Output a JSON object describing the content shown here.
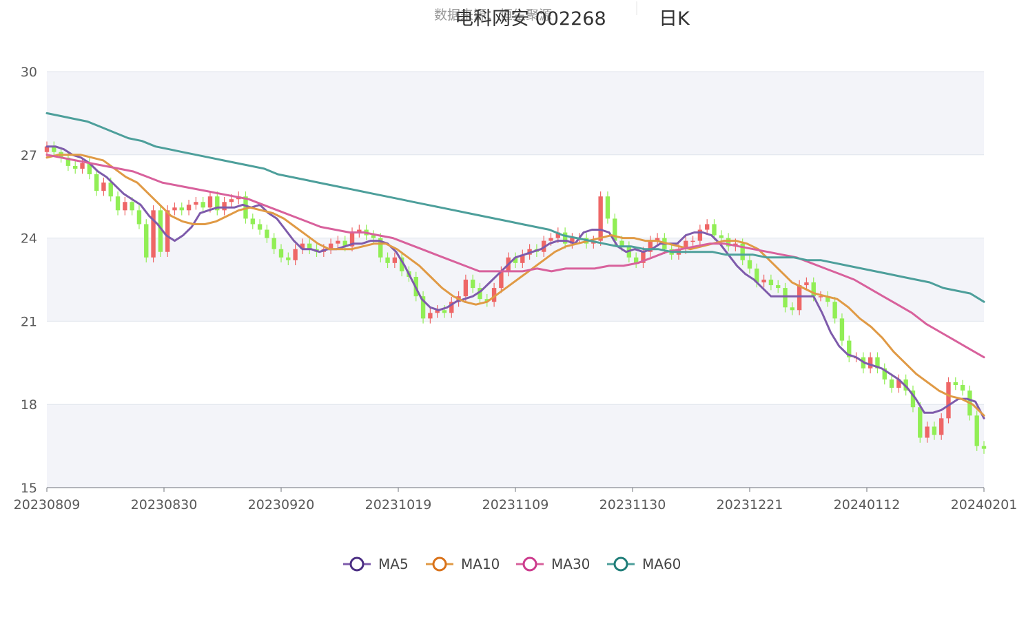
{
  "chart_data": {
    "type": "candlestick",
    "title": "电科网安 002268",
    "title_suffix": "日K",
    "source": "数据来源：恒生聚源",
    "ylim": [
      15,
      30
    ],
    "yticks": [
      15,
      18,
      21,
      24,
      27,
      30
    ],
    "xticks": [
      "20230809",
      "20230830",
      "20230920",
      "20231019",
      "20231109",
      "20231130",
      "20231221",
      "20240112",
      "20240201"
    ],
    "grid": true,
    "legend_position": "bottom-center",
    "colors": {
      "up": "#ee6666",
      "down": "#91ee55",
      "band": "#f3f4f9",
      "grid": "#e0e4ec",
      "axis": "#6e7079",
      "ma5": "#7e5bab",
      "ma10": "#e09a45",
      "ma30": "#d8619c",
      "ma60": "#4d9f9b"
    },
    "legend": [
      {
        "name": "MA5",
        "key": "ma5",
        "ring": "#4b2e83"
      },
      {
        "name": "MA10",
        "key": "ma10",
        "ring": "#d9721a"
      },
      {
        "name": "MA30",
        "key": "ma30",
        "ring": "#cc3b8d"
      },
      {
        "name": "MA60",
        "key": "ma60",
        "ring": "#1f7d78"
      }
    ],
    "close": [
      27.3,
      27.1,
      26.9,
      26.6,
      26.5,
      26.7,
      26.3,
      25.7,
      26.0,
      25.5,
      25.0,
      25.3,
      25.0,
      24.5,
      23.3,
      25.0,
      23.5,
      25.0,
      25.1,
      25.0,
      25.2,
      25.3,
      25.1,
      25.5,
      25.0,
      25.3,
      25.4,
      25.5,
      24.7,
      24.5,
      24.3,
      24.0,
      23.6,
      23.3,
      23.2,
      23.6,
      23.8,
      23.6,
      23.5,
      23.6,
      23.8,
      23.9,
      23.7,
      24.2,
      24.3,
      24.1,
      24.0,
      23.3,
      23.1,
      23.3,
      22.8,
      22.6,
      21.9,
      21.1,
      21.3,
      21.4,
      21.3,
      21.7,
      21.9,
      22.5,
      22.2,
      21.8,
      21.7,
      22.2,
      22.8,
      23.3,
      23.1,
      23.4,
      23.6,
      23.5,
      23.9,
      24.0,
      24.2,
      23.8,
      24.0,
      24.0,
      23.8,
      23.9,
      25.5,
      24.7,
      23.9,
      23.7,
      23.3,
      23.1,
      23.5,
      23.9,
      24.0,
      23.6,
      23.4,
      23.6,
      23.9,
      23.9,
      24.3,
      24.5,
      24.1,
      24.0,
      23.7,
      23.8,
      23.2,
      22.9,
      22.4,
      22.5,
      22.3,
      22.2,
      21.5,
      21.4,
      22.3,
      22.4,
      21.9,
      21.9,
      21.7,
      21.1,
      20.3,
      19.7,
      19.7,
      19.3,
      19.7,
      19.3,
      18.9,
      18.6,
      18.9,
      18.5,
      17.9,
      16.8,
      17.2,
      16.9,
      17.5,
      18.8,
      18.7,
      18.5,
      17.6,
      16.5,
      16.4
    ],
    "ma5": [
      27.3,
      27.3,
      27.2,
      27.0,
      26.9,
      26.7,
      26.4,
      26.2,
      25.9,
      25.6,
      25.4,
      25.2,
      24.8,
      24.5,
      24.1,
      23.9,
      24.1,
      24.4,
      24.9,
      25.0,
      25.1,
      25.1,
      25.1,
      25.2,
      25.1,
      25.2,
      24.9,
      24.7,
      24.3,
      23.9,
      23.6,
      23.6,
      23.5,
      23.6,
      23.6,
      23.7,
      23.8,
      23.8,
      23.9,
      23.9,
      23.8,
      23.5,
      23.0,
      22.4,
      21.8,
      21.5,
      21.4,
      21.5,
      21.7,
      21.8,
      21.9,
      22.1,
      22.4,
      22.7,
      23.0,
      23.3,
      23.4,
      23.5,
      23.6,
      23.8,
      23.9,
      23.9,
      23.8,
      24.2,
      24.3,
      24.3,
      24.2,
      23.7,
      23.5,
      23.6,
      23.5,
      23.6,
      23.8,
      23.8,
      23.8,
      24.1,
      24.2,
      24.2,
      24.1,
      23.8,
      23.4,
      23.0,
      22.7,
      22.5,
      22.2,
      21.9,
      21.9,
      21.9,
      21.9,
      21.9,
      21.9,
      21.3,
      20.6,
      20.1,
      19.8,
      19.7,
      19.5,
      19.4,
      19.3,
      19.1,
      18.9,
      18.6,
      18.2,
      17.7,
      17.7,
      17.8,
      18.0,
      18.2,
      18.2,
      18.1,
      17.5
    ],
    "ma10": [
      26.9,
      27.0,
      27.0,
      27.0,
      26.9,
      26.8,
      26.5,
      26.2,
      26.0,
      25.6,
      25.2,
      24.8,
      24.6,
      24.5,
      24.5,
      24.6,
      24.8,
      25.0,
      25.1,
      25.0,
      24.9,
      24.7,
      24.4,
      24.1,
      23.8,
      23.6,
      23.6,
      23.6,
      23.7,
      23.8,
      23.8,
      23.6,
      23.3,
      23.0,
      22.6,
      22.2,
      21.9,
      21.7,
      21.6,
      21.7,
      22.0,
      22.3,
      22.6,
      22.9,
      23.2,
      23.5,
      23.7,
      23.8,
      23.9,
      24.0,
      24.1,
      24.0,
      24.0,
      23.9,
      23.9,
      23.8,
      23.7,
      23.6,
      23.7,
      23.8,
      23.9,
      23.9,
      23.8,
      23.6,
      23.2,
      22.8,
      22.4,
      22.2,
      22.0,
      21.9,
      21.8,
      21.5,
      21.1,
      20.8,
      20.4,
      19.9,
      19.5,
      19.1,
      18.8,
      18.5,
      18.3,
      18.2,
      18.0,
      17.6
    ],
    "ma30": [
      27.0,
      26.9,
      26.8,
      26.7,
      26.6,
      26.5,
      26.4,
      26.2,
      26.0,
      25.9,
      25.8,
      25.7,
      25.6,
      25.5,
      25.4,
      25.2,
      25.0,
      24.8,
      24.6,
      24.4,
      24.3,
      24.2,
      24.2,
      24.1,
      24.0,
      23.8,
      23.6,
      23.4,
      23.2,
      23.0,
      22.8,
      22.8,
      22.8,
      22.8,
      22.9,
      22.8,
      22.9,
      22.9,
      22.9,
      23.0,
      23.0,
      23.1,
      23.3,
      23.5,
      23.6,
      23.7,
      23.8,
      23.8,
      23.7,
      23.6,
      23.5,
      23.4,
      23.3,
      23.1,
      22.9,
      22.7,
      22.5,
      22.2,
      21.9,
      21.6,
      21.3,
      20.9,
      20.6,
      20.3,
      20.0,
      19.7
    ],
    "ma60": [
      28.5,
      28.4,
      28.3,
      28.2,
      28.0,
      27.8,
      27.6,
      27.5,
      27.3,
      27.2,
      27.1,
      27.0,
      26.9,
      26.8,
      26.7,
      26.6,
      26.5,
      26.3,
      26.2,
      26.1,
      26.0,
      25.9,
      25.8,
      25.7,
      25.6,
      25.5,
      25.4,
      25.3,
      25.2,
      25.1,
      25.0,
      24.9,
      24.8,
      24.7,
      24.6,
      24.5,
      24.4,
      24.3,
      24.1,
      24.0,
      23.9,
      23.8,
      23.7,
      23.7,
      23.6,
      23.6,
      23.5,
      23.5,
      23.5,
      23.5,
      23.4,
      23.4,
      23.4,
      23.3,
      23.3,
      23.3,
      23.2,
      23.2,
      23.1,
      23.0,
      22.9,
      22.8,
      22.7,
      22.6,
      22.5,
      22.4,
      22.2,
      22.1,
      22.0,
      21.7
    ]
  }
}
